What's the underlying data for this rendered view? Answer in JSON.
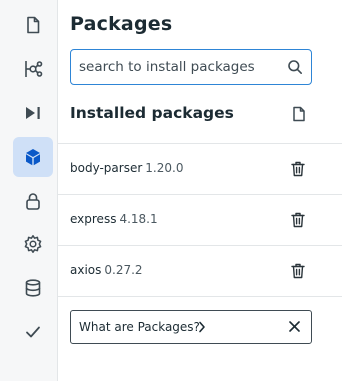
{
  "panel": {
    "title": "Packages",
    "search": {
      "placeholder": "search to install packages",
      "value": ""
    },
    "installed_title": "Installed packages",
    "packages": [
      {
        "name": "body-parser",
        "version": "1.20.0"
      },
      {
        "name": "express",
        "version": "4.18.1"
      },
      {
        "name": "axios",
        "version": "0.27.2"
      }
    ],
    "help_link": "What are Packages?"
  },
  "rail": {
    "items": [
      {
        "icon": "file-icon",
        "active": false
      },
      {
        "icon": "git-branch-icon",
        "active": false
      },
      {
        "icon": "run-debug-icon",
        "active": false
      },
      {
        "icon": "package-cube-icon",
        "active": true
      },
      {
        "icon": "lock-icon",
        "active": false
      },
      {
        "icon": "gear-icon",
        "active": false
      },
      {
        "icon": "database-icon",
        "active": false
      },
      {
        "icon": "check-icon",
        "active": false
      }
    ]
  },
  "colors": {
    "accent": "#2e85d6",
    "active_bg": "#cfe0f7",
    "rail_bg": "#f6f7f8",
    "text": "#1c2b33",
    "icon": "#3f4b53",
    "active_icon": "#0a58c8"
  }
}
